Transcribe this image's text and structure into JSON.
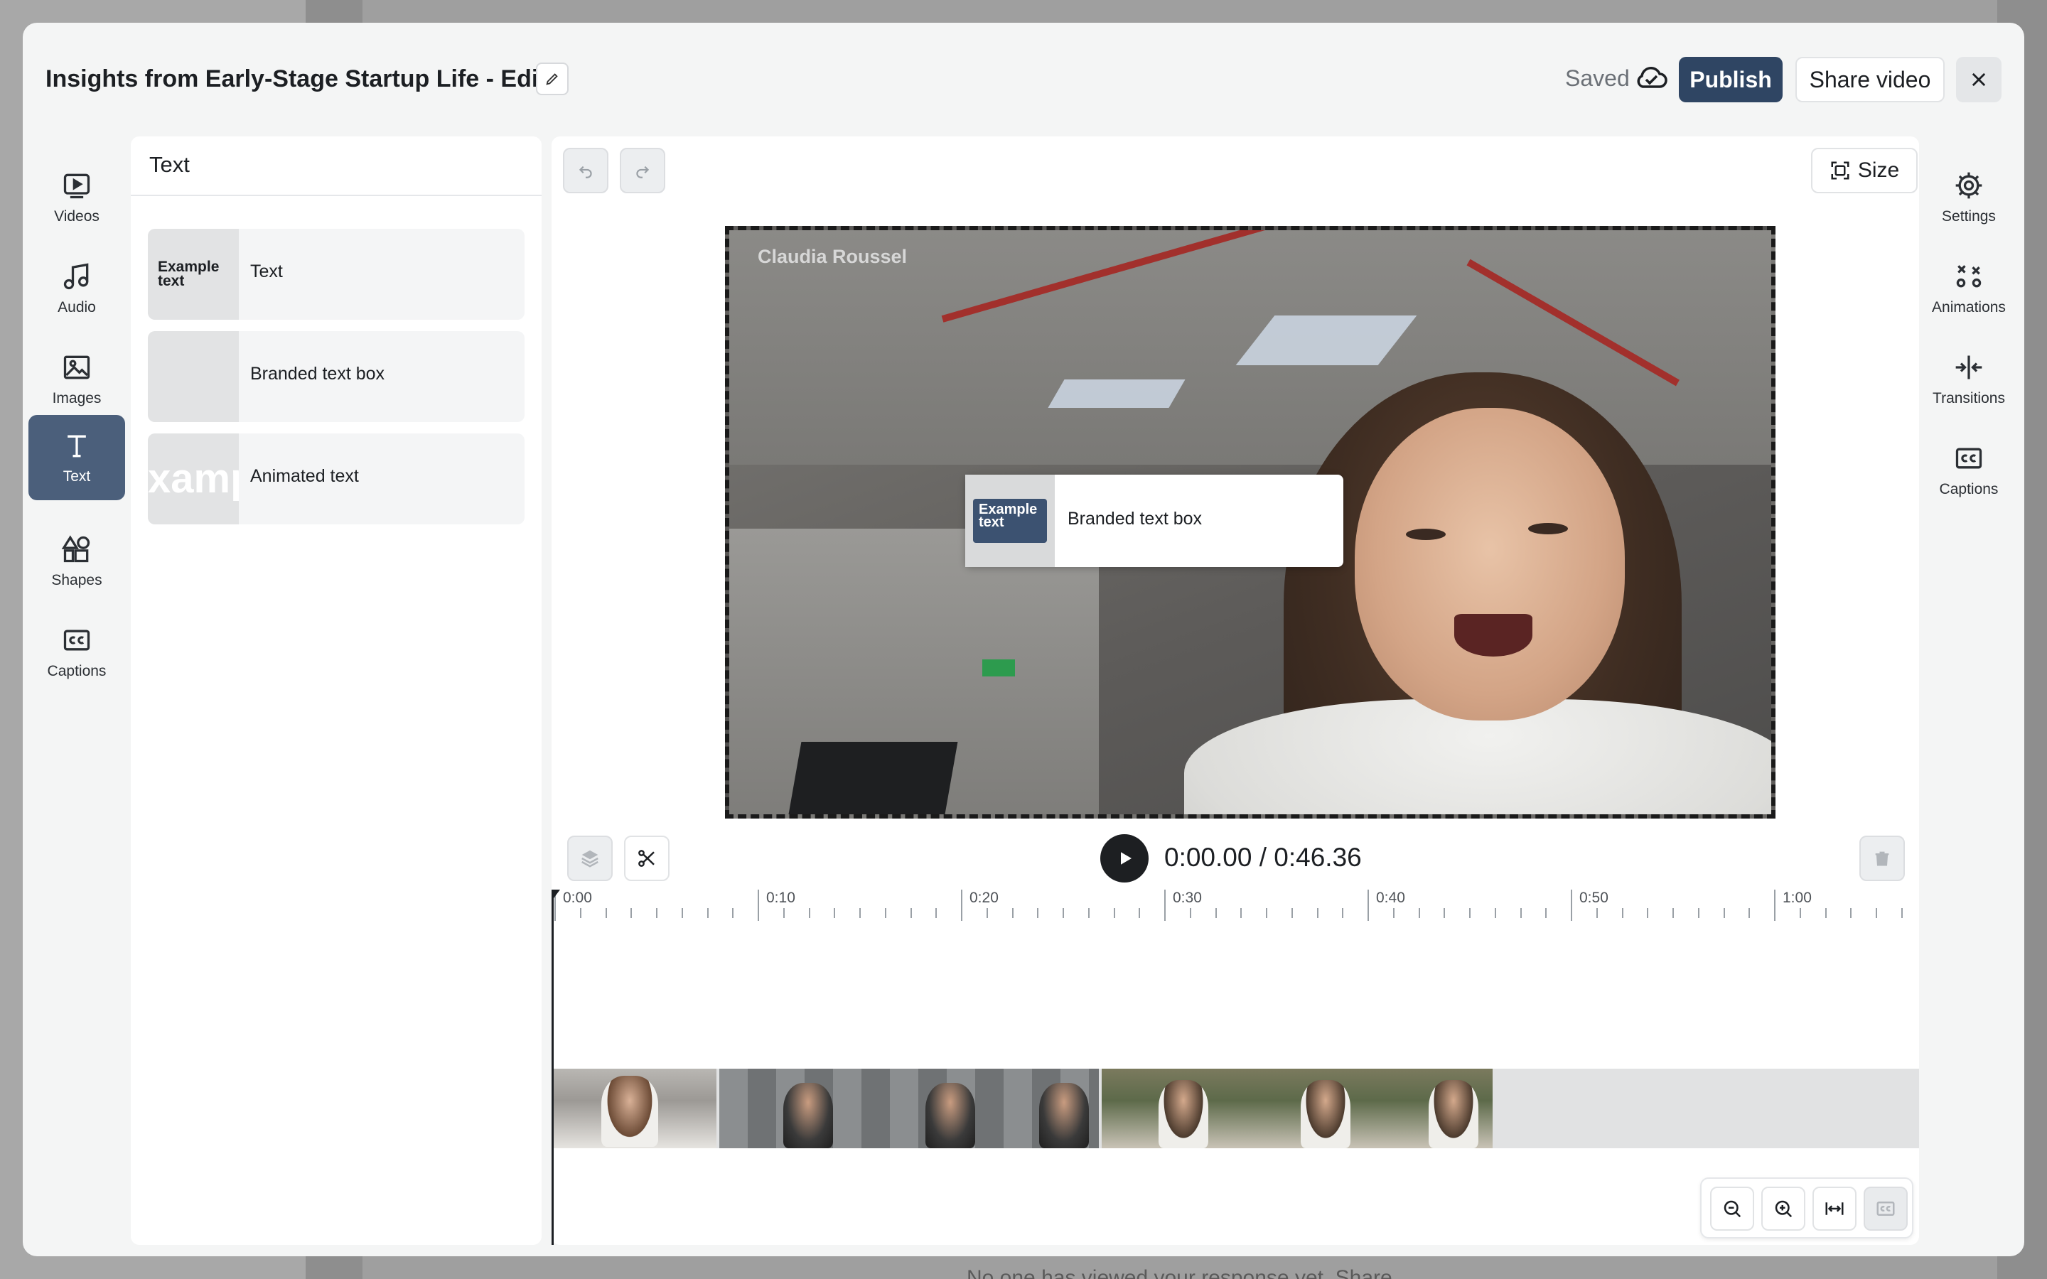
{
  "background": {
    "footer_text": "No one has viewed your response yet. Share"
  },
  "header": {
    "title": "Insights from Early-Stage Startup Life - Edit",
    "saved_label": "Saved",
    "publish_label": "Publish",
    "share_label": "Share video"
  },
  "left_rail": {
    "items": [
      {
        "label": "Videos",
        "icon": "video-icon"
      },
      {
        "label": "Audio",
        "icon": "music-note-icon"
      },
      {
        "label": "Images",
        "icon": "image-icon"
      },
      {
        "label": "Text",
        "icon": "text-icon",
        "active": true
      },
      {
        "label": "Shapes",
        "icon": "shapes-icon"
      },
      {
        "label": "Captions",
        "icon": "captions-icon"
      }
    ]
  },
  "right_rail": {
    "items": [
      {
        "label": "Settings",
        "icon": "gear-icon"
      },
      {
        "label": "Animations",
        "icon": "animations-icon"
      },
      {
        "label": "Transitions",
        "icon": "transitions-icon"
      },
      {
        "label": "Captions",
        "icon": "captions-icon"
      }
    ]
  },
  "text_panel": {
    "title": "Text",
    "items": [
      {
        "label": "Text",
        "thumb_text": "Example text"
      },
      {
        "label": "Branded text box"
      },
      {
        "label": "Animated text",
        "thumb_text": "xamp text"
      }
    ]
  },
  "preview": {
    "size_label": "Size",
    "video_caption": "Claudia Roussel",
    "overlay": {
      "thumb_text": "Example text",
      "label": "Branded text box"
    }
  },
  "timeline": {
    "time_display": "0:00.00 / 0:46.36",
    "ruler_labels": [
      "0:00",
      "0:10",
      "0:20",
      "0:30",
      "0:40",
      "0:50",
      "1:00"
    ]
  },
  "colors": {
    "primary": "#2f4563",
    "active_rail": "#4b5f7b",
    "modal_bg": "#f4f5f5"
  }
}
